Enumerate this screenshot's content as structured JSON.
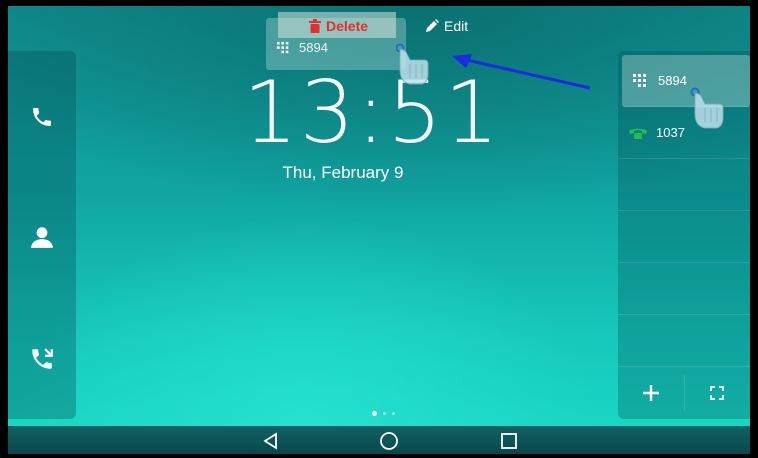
{
  "clock": {
    "time": "13:51",
    "date": "Thu, February 9"
  },
  "drag": {
    "delete_label": "Delete",
    "edit_label": "Edit",
    "number": "5894"
  },
  "left_dock": {
    "items": [
      {
        "icon": "phone-icon"
      },
      {
        "icon": "contact-icon"
      },
      {
        "icon": "call-history-icon"
      }
    ]
  },
  "right_panel": {
    "rows": [
      {
        "icon": "dialpad-icon",
        "label": "5894"
      },
      {
        "icon": "green-phone-icon",
        "label": "1037"
      }
    ],
    "bottom": [
      {
        "icon": "add-icon"
      },
      {
        "icon": "fullscreen-icon"
      }
    ]
  },
  "nav": {
    "icons": [
      "back-icon",
      "home-icon",
      "recent-apps-icon"
    ]
  },
  "colors": {
    "delete": "#e03030",
    "phone_green": "#22c04a",
    "arrow": "#1a2be0"
  }
}
